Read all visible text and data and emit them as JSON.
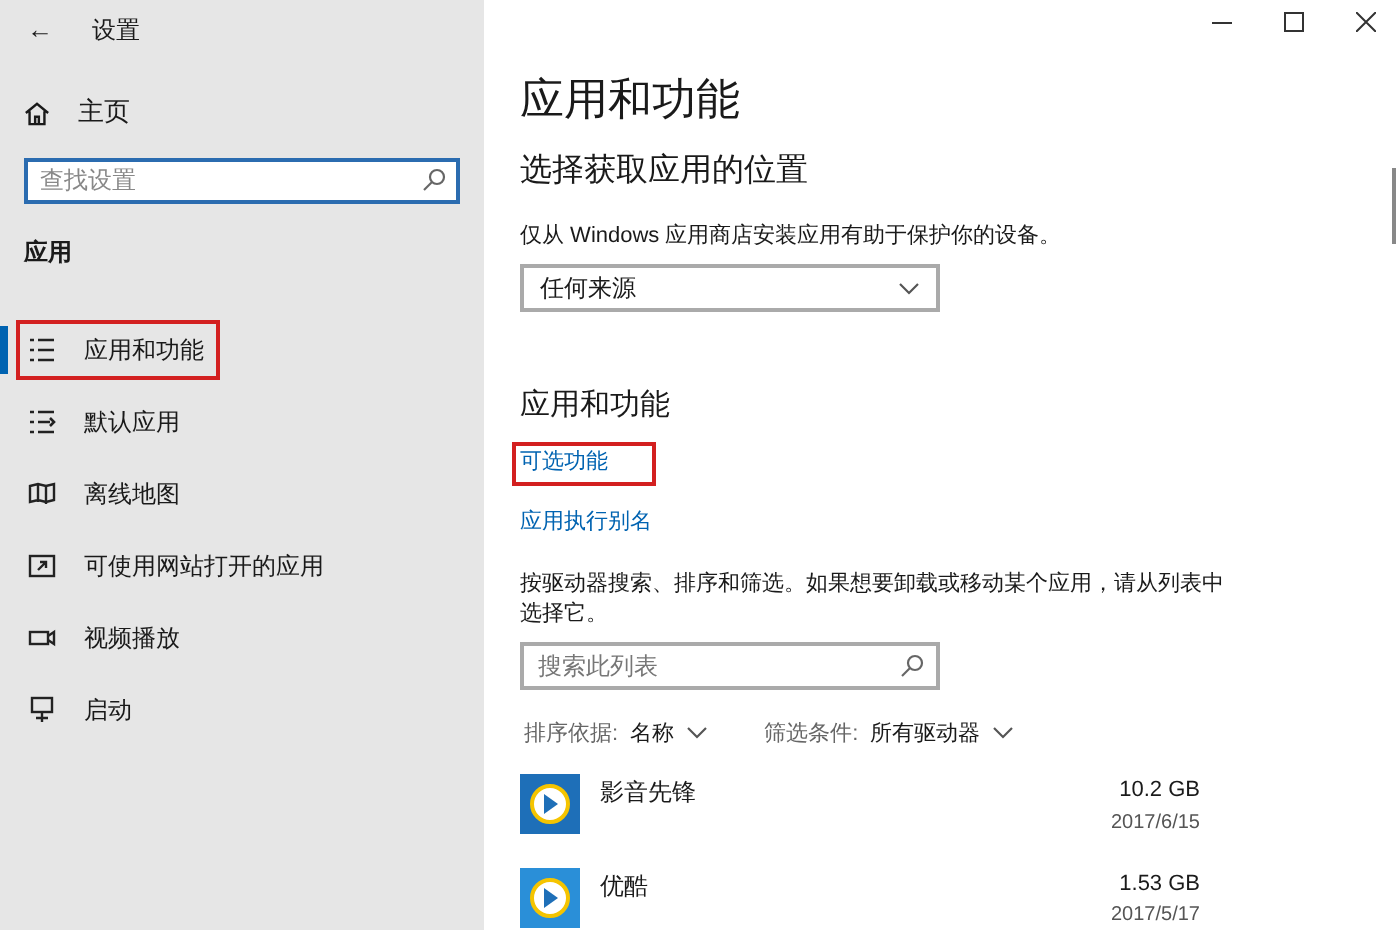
{
  "sidebar": {
    "back": "←",
    "title": "设置",
    "home": "主页",
    "search": {
      "placeholder": "查找设置"
    },
    "section": "应用",
    "items": [
      {
        "label": "应用和功能",
        "selected": true,
        "highlighted": true
      },
      {
        "label": "默认应用",
        "selected": false,
        "highlighted": false
      },
      {
        "label": "离线地图",
        "selected": false,
        "highlighted": false
      },
      {
        "label": "可使用网站打开的应用",
        "selected": false,
        "highlighted": false
      },
      {
        "label": "视频播放",
        "selected": false,
        "highlighted": false
      },
      {
        "label": "启动",
        "selected": false,
        "highlighted": false
      }
    ]
  },
  "main": {
    "title": "应用和功能",
    "source_heading": "选择获取应用的位置",
    "source_text": "仅从 Windows 应用商店安装应用有助于保护你的设备。",
    "source_dropdown": "任何来源",
    "apps_heading": "应用和功能",
    "links": [
      {
        "label": "可选功能",
        "highlighted": true
      },
      {
        "label": "应用执行别名",
        "highlighted": false
      }
    ],
    "description": "按驱动器搜索、排序和筛选。如果想要卸载或移动某个应用，请从列表中选择它。",
    "search": {
      "placeholder": "搜索此列表"
    },
    "sort": {
      "label": "排序依据:",
      "value": "名称"
    },
    "filter": {
      "label": "筛选条件:",
      "value": "所有驱动器"
    },
    "apps": [
      {
        "name": "影音先锋",
        "size": "10.2 GB",
        "date": "2017/6/15",
        "color": "#1e6fb8"
      },
      {
        "name": "优酷",
        "size": "1.53 GB",
        "date": "2017/5/17",
        "color": "#2a8fd8"
      }
    ]
  }
}
